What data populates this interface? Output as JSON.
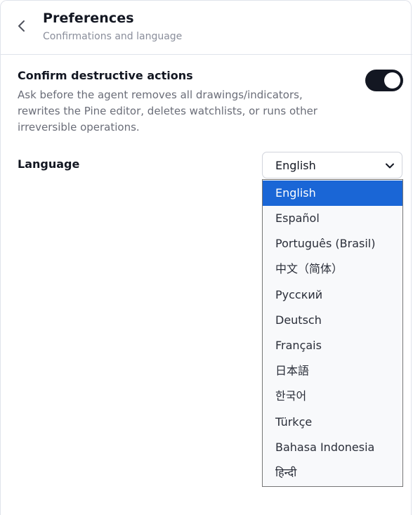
{
  "header": {
    "back_icon": "chevron-left-icon",
    "title": "Preferences",
    "subtitle": "Confirmations and language"
  },
  "confirm": {
    "title": "Confirm destructive actions",
    "description": "Ask before the agent removes all drawings/indicators, rewrites the Pine editor, deletes watchlists, or runs other irreversible operations.",
    "enabled": true
  },
  "language": {
    "label": "Language",
    "selected": "English",
    "chevron_icon": "chevron-down-icon",
    "options": [
      "English",
      "Español",
      "Português (Brasil)",
      "中文（简体）",
      "Русский",
      "Deutsch",
      "Français",
      "日本語",
      "한국어",
      "Türkçe",
      "Bahasa Indonesia",
      "हिन्दी"
    ]
  },
  "colors": {
    "accent": "#1a66d6",
    "toggle_on": "#131722"
  }
}
